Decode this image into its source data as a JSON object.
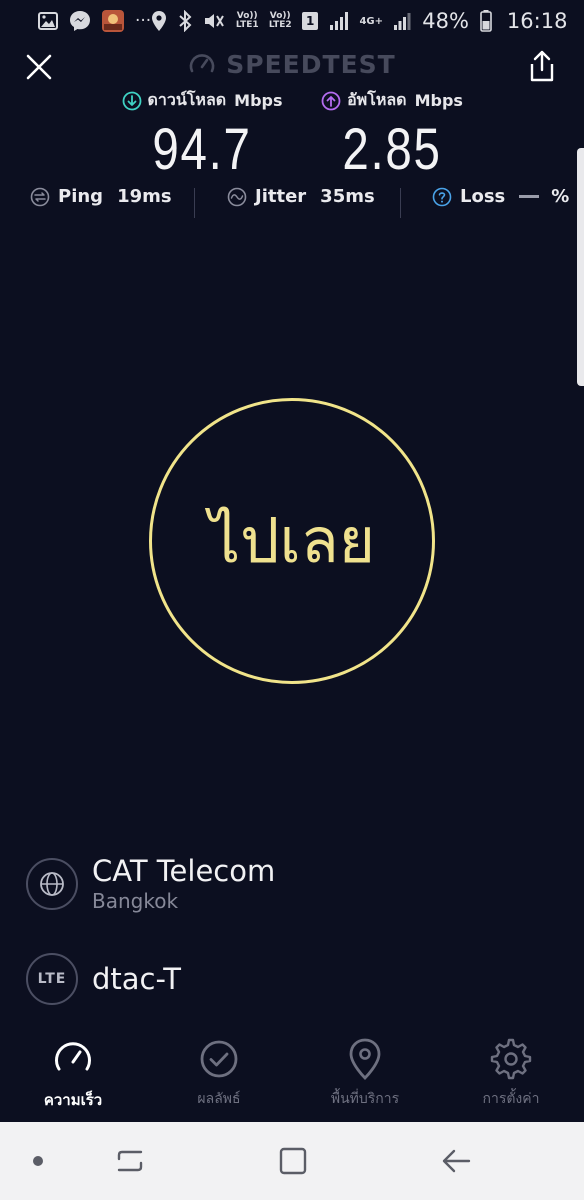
{
  "status_bar": {
    "battery_percent": "48%",
    "time": "16:18",
    "sim_badge": "1",
    "network_type": "4G+",
    "volte_1": "Vo)) LTE1",
    "volte_2": "Vo)) LTE2",
    "more": "···"
  },
  "header": {
    "title": "SPEEDTEST"
  },
  "download": {
    "label": "ดาวน์โหลด",
    "unit": "Mbps",
    "value": "94.7",
    "color": "#3fd1c3"
  },
  "upload": {
    "label": "อัพโหลด",
    "unit": "Mbps",
    "value": "2.85",
    "color": "#b46cf0"
  },
  "metrics": {
    "ping_label": "Ping",
    "ping_value": "19ms",
    "jitter_label": "Jitter",
    "jitter_value": "35ms",
    "loss_label": "Loss",
    "loss_unit": "%"
  },
  "go_button": {
    "label": "ไปเลย",
    "color": "#f1e48a"
  },
  "server": {
    "provider": "CAT Telecom",
    "location": "Bangkok",
    "network_badge": "LTE",
    "network_name": "dtac-T"
  },
  "bottom_nav": {
    "items": [
      {
        "label": "ความเร็ว",
        "icon": "speedometer-icon",
        "active": true
      },
      {
        "label": "ผลลัพธ์",
        "icon": "check-circle-icon",
        "active": false
      },
      {
        "label": "พื้นที่บริการ",
        "icon": "map-pin-icon",
        "active": false
      },
      {
        "label": "การตั้งค่า",
        "icon": "gear-icon",
        "active": false
      }
    ]
  }
}
